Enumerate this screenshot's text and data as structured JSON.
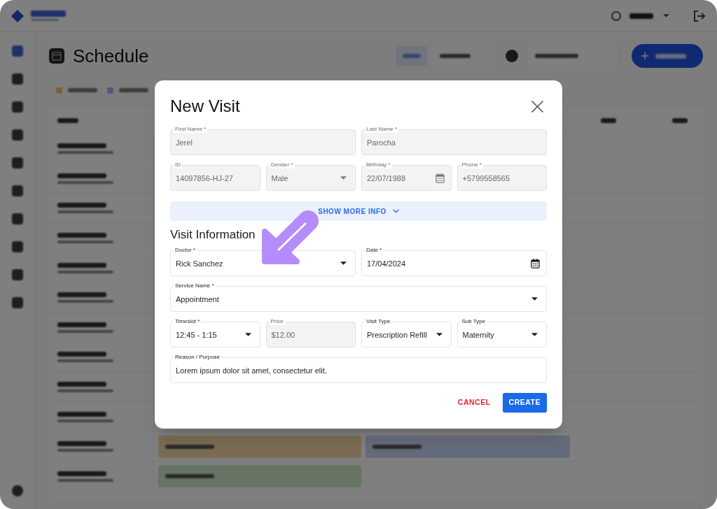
{
  "app": {
    "page_title": "Schedule"
  },
  "dialog": {
    "title": "New Visit",
    "patient_rows": [
      {
        "fields": [
          {
            "label": "First Name *",
            "value": "Jerel",
            "kind": "text",
            "disabled": true
          },
          {
            "label": "Last Name *",
            "value": "Parocha",
            "kind": "text",
            "disabled": true
          }
        ]
      },
      {
        "fields": [
          {
            "label": "ID",
            "value": "14097856-HJ-27",
            "kind": "text",
            "disabled": true
          },
          {
            "label": "Gender *",
            "value": "Male",
            "kind": "select",
            "disabled": true
          },
          {
            "label": "Birthday *",
            "value": "22/07/1988",
            "kind": "date",
            "disabled": true
          },
          {
            "label": "Phone *",
            "value": "+5799558565",
            "kind": "text",
            "disabled": true
          }
        ]
      }
    ],
    "show_more": {
      "label": "SHOW MORE INFO",
      "expanded": false
    },
    "section_title": "Visit Information",
    "visit_rows": [
      {
        "fields": [
          {
            "label": "Doctor *",
            "value": "Rick Sanchez",
            "kind": "select",
            "disabled": false
          },
          {
            "label": "Date *",
            "value": "17/04/2024",
            "kind": "date",
            "disabled": false
          }
        ]
      },
      {
        "fields": [
          {
            "label": "Service Name *",
            "value": "Appointment",
            "kind": "select",
            "disabled": false
          }
        ]
      },
      {
        "fields": [
          {
            "label": "Timeslot *",
            "value": "12:45 - 1:15",
            "kind": "select",
            "disabled": false
          },
          {
            "label": "Price",
            "value": "$12.00",
            "kind": "text",
            "disabled": true
          },
          {
            "label": "Visit Type",
            "value": "Prescription Refill",
            "kind": "select",
            "disabled": false
          },
          {
            "label": "Sub Type",
            "value": "Maternity",
            "kind": "select",
            "disabled": false
          }
        ]
      },
      {
        "fields": [
          {
            "label": "Reason / Purpose",
            "value": "Lorem ipsum dolor sit amet, consectetur elit.",
            "kind": "text",
            "disabled": false
          }
        ]
      }
    ],
    "buttons": [
      {
        "label": "CANCEL",
        "kind": "cancel"
      },
      {
        "label": "CREATE",
        "kind": "submit"
      }
    ]
  }
}
